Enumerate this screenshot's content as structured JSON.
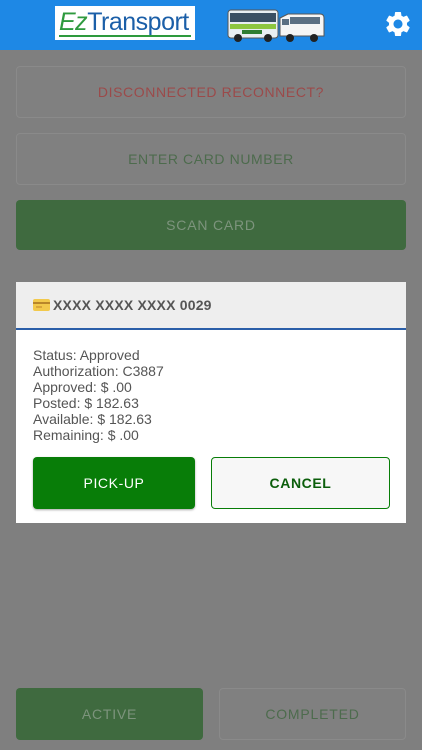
{
  "header": {
    "logo_prefix": "Ez",
    "logo_suffix": "Transport",
    "settings_icon": "gear-icon",
    "brand_color": "#1e88e5"
  },
  "form": {
    "connection_status": "DISCONNECTED RECONNECT?",
    "card_placeholder": "ENTER CARD NUMBER",
    "scan_label": "SCAN CARD"
  },
  "dialog": {
    "card_icon": "credit-card-icon",
    "card_number": "XXXX XXXX XXXX 0029",
    "details": [
      "Status: Approved",
      "Authorization: C3887",
      "Approved: $ .00",
      "Posted: $ 182.63",
      "Available: $ 182.63",
      "Remaining: $ .00"
    ],
    "pickup_label": "PICK-UP",
    "cancel_label": "CANCEL",
    "accent_color": "#087d08"
  },
  "bottom": {
    "active_label": "ACTIVE",
    "completed_label": "COMPLETED"
  }
}
